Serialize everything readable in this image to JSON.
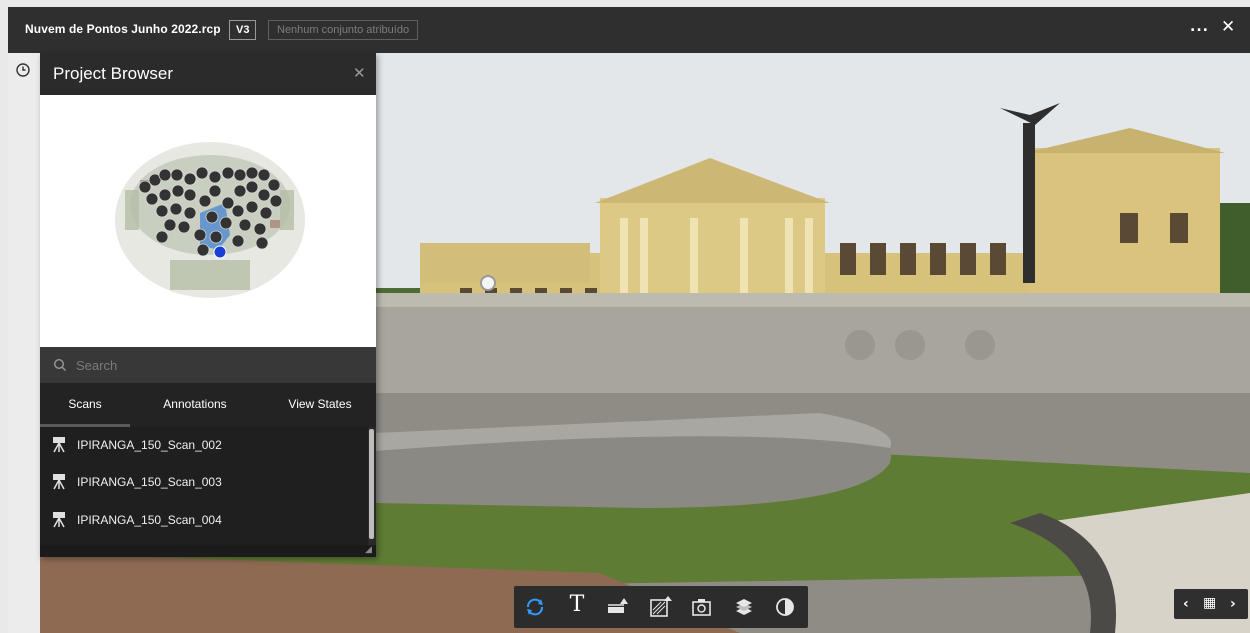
{
  "app": {
    "file_title": "Nuvem de Pontos Junho 2022.rcp",
    "version": "V3",
    "set_status": "Nenhum conjunto atribuído",
    "more_label": "...",
    "close_label": "✕"
  },
  "panel": {
    "title": "Project Browser",
    "close_label": "✕",
    "search_placeholder": "Search",
    "tabs": [
      {
        "label": "Scans",
        "active": true
      },
      {
        "label": "Annotations",
        "active": false
      },
      {
        "label": "View States",
        "active": false
      }
    ],
    "scans": [
      {
        "label": "IPIRANGA_150_Scan_002"
      },
      {
        "label": "IPIRANGA_150_Scan_003"
      },
      {
        "label": "IPIRANGA_150_Scan_004"
      }
    ]
  },
  "toolbar": {
    "tools": [
      "orbit-icon",
      "text-icon",
      "measure-icon",
      "section-box-icon",
      "snapshot-icon",
      "layers-icon",
      "display-mode-icon"
    ],
    "text_tool_glyph": "T"
  },
  "navigation": {
    "prev_label": "‹",
    "next_label": "›",
    "grid_label": "▦"
  },
  "colors": {
    "topbar": "#2f2f2f",
    "panel": "#1b1b1b",
    "accent": "#1f88e5",
    "scan_marker": "#333333",
    "selected_marker": "#1a3fd6"
  }
}
